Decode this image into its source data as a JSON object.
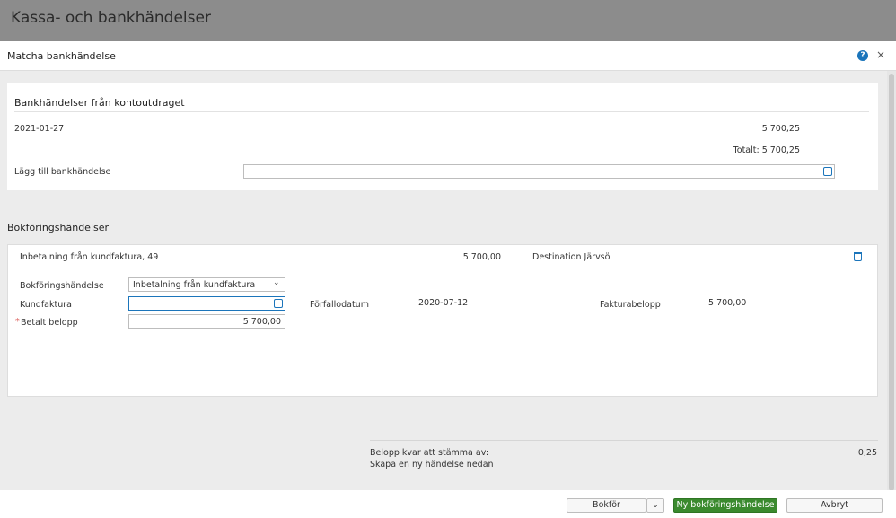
{
  "app": {
    "title": "Kassa- och bankhändelser"
  },
  "modal": {
    "title": "Matcha bankhändelse",
    "help_icon": "?",
    "close_icon": "×"
  },
  "bank": {
    "section_title": "Bankhändelser från kontoutdraget",
    "row": {
      "date": "2021-01-27",
      "amount": "5 700,25"
    },
    "total": "Totalt: 5 700,25",
    "add_label": "Lägg till bankhändelse",
    "add_value": ""
  },
  "booking": {
    "section_title": "Bokföringshändelser",
    "row": {
      "description": "Inbetalning från kundfaktura, 49",
      "amount": "5 700,00",
      "customer": "Destination Järvsö"
    },
    "fields": {
      "event_label": "Bokföringshändelse",
      "event_value": "Inbetalning från kundfaktura",
      "invoice_label": "Kundfaktura",
      "invoice_value": "",
      "paid_label": "Betalt belopp",
      "paid_required": "*",
      "paid_value": "5 700,00",
      "due_label": "Förfallodatum",
      "due_value": "2020-07-12",
      "invoice_amount_label": "Fakturabelopp",
      "invoice_amount_value": "5 700,00"
    }
  },
  "summary": {
    "remaining_label": "Belopp kvar att stämma av:",
    "remaining_value": "0,25",
    "hint": "Skapa en ny händelse nedan"
  },
  "footer": {
    "post_label": "Bokför",
    "new_event_label": "Ny bokföringshändelse",
    "cancel_label": "Avbryt"
  },
  "colors": {
    "accent": "#1b75bb",
    "primary_button": "#3a8a2e",
    "required": "#d9534f"
  }
}
